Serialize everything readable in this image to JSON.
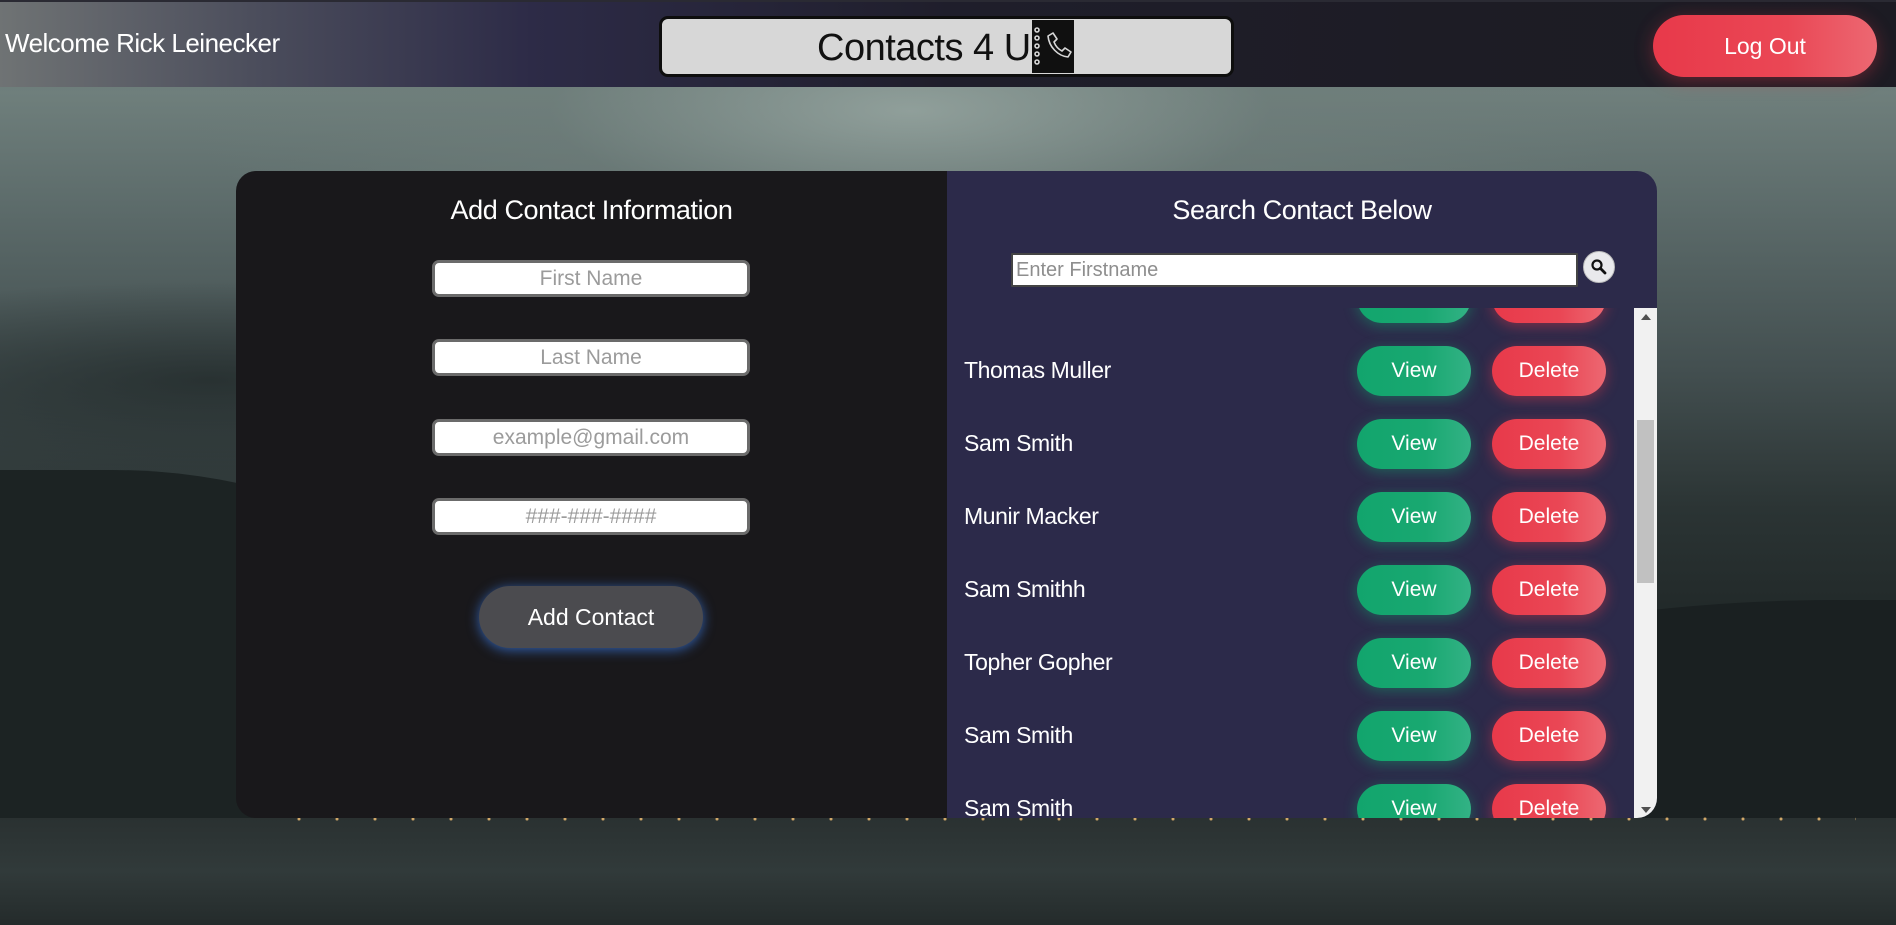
{
  "header": {
    "welcome_text": "Welcome Rick Leinecker",
    "brand_title": "Contacts 4 U",
    "logout_label": "Log Out"
  },
  "add_panel": {
    "title": "Add Contact Information",
    "first_name_placeholder": "First Name",
    "last_name_placeholder": "Last Name",
    "email_placeholder": "example@gmail.com",
    "phone_placeholder": "###-###-####",
    "add_button_label": "Add Contact"
  },
  "search_panel": {
    "title": "Search Contact Below",
    "search_placeholder": "Enter Firstname",
    "view_label": "View",
    "delete_label": "Delete",
    "contacts": [
      {
        "name": ""
      },
      {
        "name": "Thomas Muller"
      },
      {
        "name": "Sam Smith"
      },
      {
        "name": "Munir Macker"
      },
      {
        "name": "Sam Smithh"
      },
      {
        "name": "Topher Gopher"
      },
      {
        "name": "Sam Smith"
      },
      {
        "name": "Sam Smith"
      }
    ]
  },
  "colors": {
    "view_green": "#12a56d",
    "delete_red": "#e8394a",
    "search_panel_bg": "#2c2a4a",
    "add_panel_bg": "#19181b"
  },
  "icons": {
    "brand": "phone-notebook-icon",
    "search": "magnifier-icon"
  }
}
